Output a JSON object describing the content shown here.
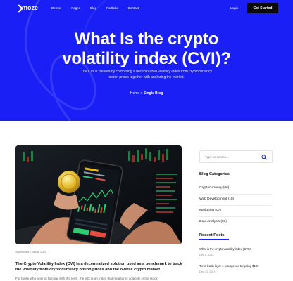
{
  "nav": {
    "logo": "moze",
    "links": [
      "Demos",
      "Pages",
      "Blog",
      "Portfolio",
      "Contact"
    ],
    "login": "Login",
    "cta": "Get Started"
  },
  "hero": {
    "title_line1": "What Is the crypto",
    "title_line2": "volatility index (CVI)?",
    "subtitle": "The CVI is created by computing a decentralized volatility index from cryptocurrency option prices together with analyzing the market.",
    "breadcrumb_home": "Home",
    "breadcrumb_sep": ">",
    "breadcrumb_current": "Single Blog"
  },
  "article": {
    "meta": "Sponsored | Dec 6, 2022",
    "intro": "The Crypto Volatility Index (CVI) is a decentralized solution used as a benchmark to track the volatility from cryptocurrency option prices and the overall crypto market.",
    "body_start": "For those who are not familiar with the term, the VIX is an index that measures volatility in the stock"
  },
  "sidebar": {
    "search_placeholder": "Type to search...",
    "categories_heading": "Blog Categories",
    "categories": [
      {
        "label": "Cryptocurrency (06)"
      },
      {
        "label": "Web Development (18)"
      },
      {
        "label": "Marketing (07)"
      },
      {
        "label": "Data Analysis (03)"
      }
    ],
    "recent_heading": "Recent Posts",
    "recent": [
      {
        "title": "What is the crypto volatility index (CVI)?",
        "date": "Dec. 6, 2022"
      },
      {
        "title": "Terra leads layer 1 resurgence targeting $100",
        "date": "Dec. 22, 2021"
      }
    ]
  },
  "colors": {
    "brand": "#1a1ff5",
    "cta": "#0a0a0a"
  }
}
